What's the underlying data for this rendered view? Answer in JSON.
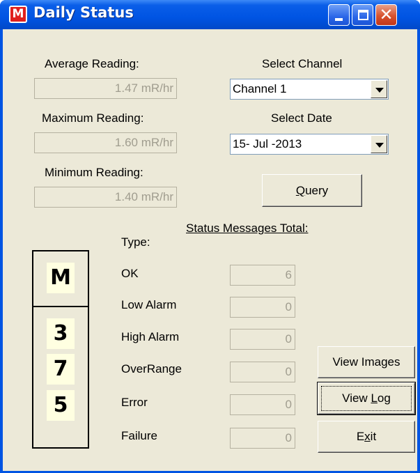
{
  "window": {
    "title": "Daily Status",
    "icon_letter": "M",
    "close_glyph": "✕"
  },
  "readings": {
    "average_label": "Average Reading:",
    "average_value": "1.47  mR/hr",
    "maximum_label": "Maximum Reading:",
    "maximum_value": "1.60  mR/hr",
    "minimum_label": "Minimum Reading:",
    "minimum_value": "1.40  mR/hr"
  },
  "channel": {
    "label": "Select Channel",
    "selected": "Channel 1"
  },
  "date": {
    "label": "Select Date",
    "selected": "15- Jul -2013"
  },
  "query_button": {
    "underlined": "Q",
    "rest": "uery"
  },
  "status": {
    "type_label": "Type:",
    "totals_label": "Status Messages Total:",
    "rows": [
      {
        "type": "OK",
        "count": "6"
      },
      {
        "type": "Low Alarm",
        "count": "0"
      },
      {
        "type": "High Alarm",
        "count": "0"
      },
      {
        "type": "OverRange",
        "count": "0"
      },
      {
        "type": "Error",
        "count": "0"
      },
      {
        "type": "Failure",
        "count": "0"
      }
    ]
  },
  "code_display": {
    "top": "M",
    "digits": [
      "3",
      "7",
      "5"
    ]
  },
  "buttons": {
    "view_images": "View Images",
    "view_log_pre": "View ",
    "view_log_underlined": "L",
    "view_log_post": "og",
    "exit_pre": "E",
    "exit_underlined": "x",
    "exit_post": "it"
  },
  "colors": {
    "title_bar": "#0054e3",
    "client_bg": "#ece9d8",
    "close_button": "#d8532f",
    "code_highlight": "#ffffe1"
  }
}
